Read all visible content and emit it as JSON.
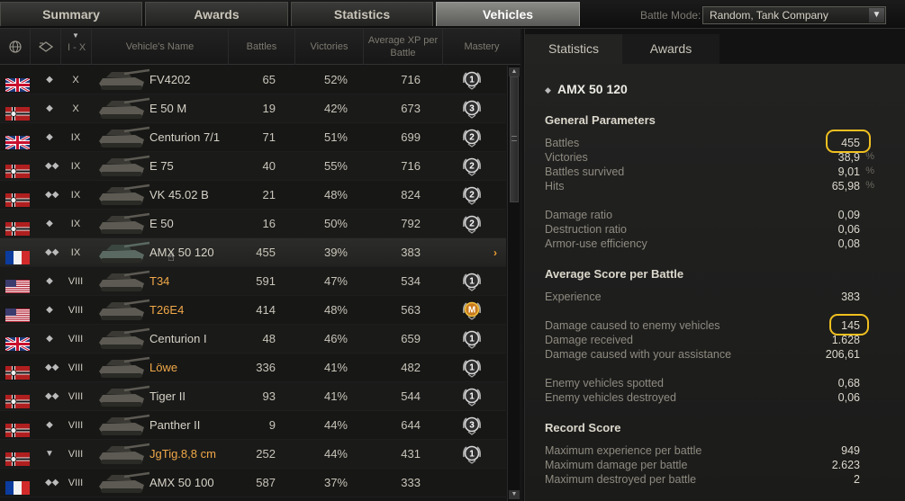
{
  "tabs": {
    "summary": "Summary",
    "awards": "Awards",
    "statistics": "Statistics",
    "vehicles": "Vehicles"
  },
  "battle_mode": {
    "label": "Battle Mode:",
    "value": "Random, Tank Company"
  },
  "table": {
    "headers": {
      "tier": "I - X",
      "name": "Vehicle's Name",
      "battles": "Battles",
      "victories": "Victories",
      "avg_xp": "Average XP per Battle",
      "mastery": "Mastery"
    },
    "rows": [
      {
        "nation": "uk",
        "type": "◆",
        "tier": "X",
        "name": "FV4202",
        "battles": "65",
        "victories": "52%",
        "avg_xp": "716",
        "mastery": "1",
        "premium": false,
        "selected": false
      },
      {
        "nation": "de",
        "type": "◆",
        "tier": "X",
        "name": "E 50 M",
        "battles": "19",
        "victories": "42%",
        "avg_xp": "673",
        "mastery": "3",
        "premium": false,
        "selected": false
      },
      {
        "nation": "uk",
        "type": "◆",
        "tier": "IX",
        "name": "Centurion 7/1",
        "battles": "71",
        "victories": "51%",
        "avg_xp": "699",
        "mastery": "2",
        "premium": false,
        "selected": false
      },
      {
        "nation": "de",
        "type": "◆◆",
        "tier": "IX",
        "name": "E 75",
        "battles": "40",
        "victories": "55%",
        "avg_xp": "716",
        "mastery": "2",
        "premium": false,
        "selected": false
      },
      {
        "nation": "de",
        "type": "◆◆",
        "tier": "IX",
        "name": "VK 45.02 B",
        "battles": "21",
        "victories": "48%",
        "avg_xp": "824",
        "mastery": "2",
        "premium": false,
        "selected": false
      },
      {
        "nation": "de",
        "type": "◆",
        "tier": "IX",
        "name": "E 50",
        "battles": "16",
        "victories": "50%",
        "avg_xp": "792",
        "mastery": "2",
        "premium": false,
        "selected": false
      },
      {
        "nation": "fr",
        "type": "◆◆",
        "tier": "IX",
        "name": "AMX 50 120",
        "battles": "455",
        "victories": "39%",
        "avg_xp": "383",
        "mastery": "",
        "premium": false,
        "selected": true
      },
      {
        "nation": "us",
        "type": "◆",
        "tier": "VIII",
        "name": "T34",
        "battles": "591",
        "victories": "47%",
        "avg_xp": "534",
        "mastery": "1",
        "premium": true,
        "selected": false
      },
      {
        "nation": "us",
        "type": "◆",
        "tier": "VIII",
        "name": "T26E4",
        "battles": "414",
        "victories": "48%",
        "avg_xp": "563",
        "mastery": "M",
        "premium": true,
        "selected": false
      },
      {
        "nation": "uk",
        "type": "◆",
        "tier": "VIII",
        "name": "Centurion I",
        "battles": "48",
        "victories": "46%",
        "avg_xp": "659",
        "mastery": "1",
        "premium": false,
        "selected": false
      },
      {
        "nation": "de",
        "type": "◆◆",
        "tier": "VIII",
        "name": "Löwe",
        "battles": "336",
        "victories": "41%",
        "avg_xp": "482",
        "mastery": "1",
        "premium": true,
        "selected": false
      },
      {
        "nation": "de",
        "type": "◆◆",
        "tier": "VIII",
        "name": "Tiger II",
        "battles": "93",
        "victories": "41%",
        "avg_xp": "544",
        "mastery": "1",
        "premium": false,
        "selected": false
      },
      {
        "nation": "de",
        "type": "◆",
        "tier": "VIII",
        "name": "Panther II",
        "battles": "9",
        "victories": "44%",
        "avg_xp": "644",
        "mastery": "3",
        "premium": false,
        "selected": false
      },
      {
        "nation": "de",
        "type": "▼",
        "tier": "VIII",
        "name": "JgTig.8,8 cm",
        "battles": "252",
        "victories": "44%",
        "avg_xp": "431",
        "mastery": "1",
        "premium": true,
        "selected": false
      },
      {
        "nation": "fr",
        "type": "◆◆",
        "tier": "VIII",
        "name": "AMX 50 100",
        "battles": "587",
        "victories": "37%",
        "avg_xp": "333",
        "mastery": "",
        "premium": false,
        "selected": false
      }
    ]
  },
  "detail": {
    "tabs": {
      "statistics": "Statistics",
      "awards": "Awards"
    },
    "vehicle_name": "AMX 50 120",
    "general": {
      "title": "General Parameters",
      "battles": {
        "label": "Battles",
        "value": "455"
      },
      "victories": {
        "label": "Victories",
        "value": "38,9",
        "unit": "%"
      },
      "survived": {
        "label": "Battles survived",
        "value": "9,01",
        "unit": "%"
      },
      "hits": {
        "label": "Hits",
        "value": "65,98",
        "unit": "%"
      },
      "damage_ratio": {
        "label": "Damage ratio",
        "value": "0,09"
      },
      "destruction_ratio": {
        "label": "Destruction ratio",
        "value": "0,06"
      },
      "armor_use": {
        "label": "Armor-use efficiency",
        "value": "0,08"
      }
    },
    "average": {
      "title": "Average Score per Battle",
      "experience": {
        "label": "Experience",
        "value": "383"
      },
      "damage_caused": {
        "label": "Damage caused to enemy vehicles",
        "value": "145"
      },
      "damage_received": {
        "label": "Damage received",
        "value": "1.628"
      },
      "damage_assist": {
        "label": "Damage caused with your assistance",
        "value": "206,61"
      },
      "spotted": {
        "label": "Enemy vehicles spotted",
        "value": "0,68"
      },
      "destroyed": {
        "label": "Enemy vehicles destroyed",
        "value": "0,06"
      }
    },
    "record": {
      "title": "Record Score",
      "max_xp": {
        "label": "Maximum experience per battle",
        "value": "949"
      },
      "max_damage": {
        "label": "Maximum damage per battle",
        "value": "2.623"
      },
      "max_destroyed": {
        "label": "Maximum destroyed per battle",
        "value": "2"
      }
    }
  },
  "colors": {
    "premium_name": "#f0a848",
    "highlight": "#f0c020",
    "selected_chevron": "#f0a030"
  }
}
